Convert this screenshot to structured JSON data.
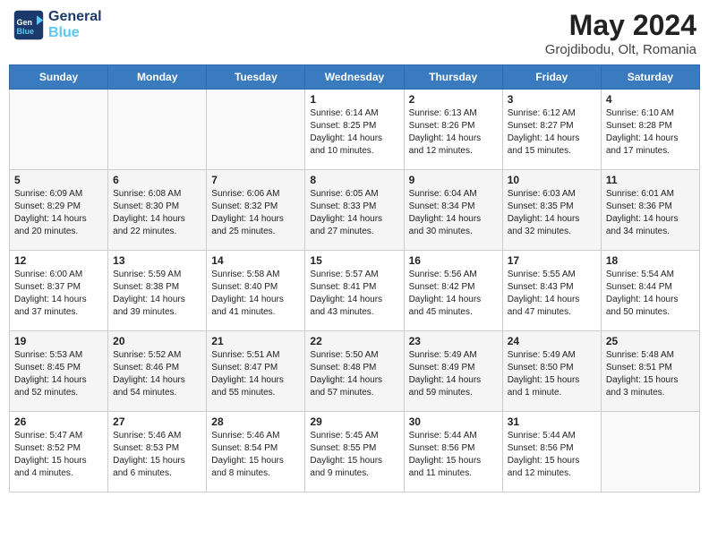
{
  "header": {
    "logo_line1": "General",
    "logo_line2": "Blue",
    "month_title": "May 2024",
    "subtitle": "Grojdibodu, Olt, Romania"
  },
  "days_of_week": [
    "Sunday",
    "Monday",
    "Tuesday",
    "Wednesday",
    "Thursday",
    "Friday",
    "Saturday"
  ],
  "weeks": [
    [
      {
        "day": "",
        "content": ""
      },
      {
        "day": "",
        "content": ""
      },
      {
        "day": "",
        "content": ""
      },
      {
        "day": "1",
        "content": "Sunrise: 6:14 AM\nSunset: 8:25 PM\nDaylight: 14 hours\nand 10 minutes."
      },
      {
        "day": "2",
        "content": "Sunrise: 6:13 AM\nSunset: 8:26 PM\nDaylight: 14 hours\nand 12 minutes."
      },
      {
        "day": "3",
        "content": "Sunrise: 6:12 AM\nSunset: 8:27 PM\nDaylight: 14 hours\nand 15 minutes."
      },
      {
        "day": "4",
        "content": "Sunrise: 6:10 AM\nSunset: 8:28 PM\nDaylight: 14 hours\nand 17 minutes."
      }
    ],
    [
      {
        "day": "5",
        "content": "Sunrise: 6:09 AM\nSunset: 8:29 PM\nDaylight: 14 hours\nand 20 minutes."
      },
      {
        "day": "6",
        "content": "Sunrise: 6:08 AM\nSunset: 8:30 PM\nDaylight: 14 hours\nand 22 minutes."
      },
      {
        "day": "7",
        "content": "Sunrise: 6:06 AM\nSunset: 8:32 PM\nDaylight: 14 hours\nand 25 minutes."
      },
      {
        "day": "8",
        "content": "Sunrise: 6:05 AM\nSunset: 8:33 PM\nDaylight: 14 hours\nand 27 minutes."
      },
      {
        "day": "9",
        "content": "Sunrise: 6:04 AM\nSunset: 8:34 PM\nDaylight: 14 hours\nand 30 minutes."
      },
      {
        "day": "10",
        "content": "Sunrise: 6:03 AM\nSunset: 8:35 PM\nDaylight: 14 hours\nand 32 minutes."
      },
      {
        "day": "11",
        "content": "Sunrise: 6:01 AM\nSunset: 8:36 PM\nDaylight: 14 hours\nand 34 minutes."
      }
    ],
    [
      {
        "day": "12",
        "content": "Sunrise: 6:00 AM\nSunset: 8:37 PM\nDaylight: 14 hours\nand 37 minutes."
      },
      {
        "day": "13",
        "content": "Sunrise: 5:59 AM\nSunset: 8:38 PM\nDaylight: 14 hours\nand 39 minutes."
      },
      {
        "day": "14",
        "content": "Sunrise: 5:58 AM\nSunset: 8:40 PM\nDaylight: 14 hours\nand 41 minutes."
      },
      {
        "day": "15",
        "content": "Sunrise: 5:57 AM\nSunset: 8:41 PM\nDaylight: 14 hours\nand 43 minutes."
      },
      {
        "day": "16",
        "content": "Sunrise: 5:56 AM\nSunset: 8:42 PM\nDaylight: 14 hours\nand 45 minutes."
      },
      {
        "day": "17",
        "content": "Sunrise: 5:55 AM\nSunset: 8:43 PM\nDaylight: 14 hours\nand 47 minutes."
      },
      {
        "day": "18",
        "content": "Sunrise: 5:54 AM\nSunset: 8:44 PM\nDaylight: 14 hours\nand 50 minutes."
      }
    ],
    [
      {
        "day": "19",
        "content": "Sunrise: 5:53 AM\nSunset: 8:45 PM\nDaylight: 14 hours\nand 52 minutes."
      },
      {
        "day": "20",
        "content": "Sunrise: 5:52 AM\nSunset: 8:46 PM\nDaylight: 14 hours\nand 54 minutes."
      },
      {
        "day": "21",
        "content": "Sunrise: 5:51 AM\nSunset: 8:47 PM\nDaylight: 14 hours\nand 55 minutes."
      },
      {
        "day": "22",
        "content": "Sunrise: 5:50 AM\nSunset: 8:48 PM\nDaylight: 14 hours\nand 57 minutes."
      },
      {
        "day": "23",
        "content": "Sunrise: 5:49 AM\nSunset: 8:49 PM\nDaylight: 14 hours\nand 59 minutes."
      },
      {
        "day": "24",
        "content": "Sunrise: 5:49 AM\nSunset: 8:50 PM\nDaylight: 15 hours\nand 1 minute."
      },
      {
        "day": "25",
        "content": "Sunrise: 5:48 AM\nSunset: 8:51 PM\nDaylight: 15 hours\nand 3 minutes."
      }
    ],
    [
      {
        "day": "26",
        "content": "Sunrise: 5:47 AM\nSunset: 8:52 PM\nDaylight: 15 hours\nand 4 minutes."
      },
      {
        "day": "27",
        "content": "Sunrise: 5:46 AM\nSunset: 8:53 PM\nDaylight: 15 hours\nand 6 minutes."
      },
      {
        "day": "28",
        "content": "Sunrise: 5:46 AM\nSunset: 8:54 PM\nDaylight: 15 hours\nand 8 minutes."
      },
      {
        "day": "29",
        "content": "Sunrise: 5:45 AM\nSunset: 8:55 PM\nDaylight: 15 hours\nand 9 minutes."
      },
      {
        "day": "30",
        "content": "Sunrise: 5:44 AM\nSunset: 8:56 PM\nDaylight: 15 hours\nand 11 minutes."
      },
      {
        "day": "31",
        "content": "Sunrise: 5:44 AM\nSunset: 8:56 PM\nDaylight: 15 hours\nand 12 minutes."
      },
      {
        "day": "",
        "content": ""
      }
    ]
  ]
}
